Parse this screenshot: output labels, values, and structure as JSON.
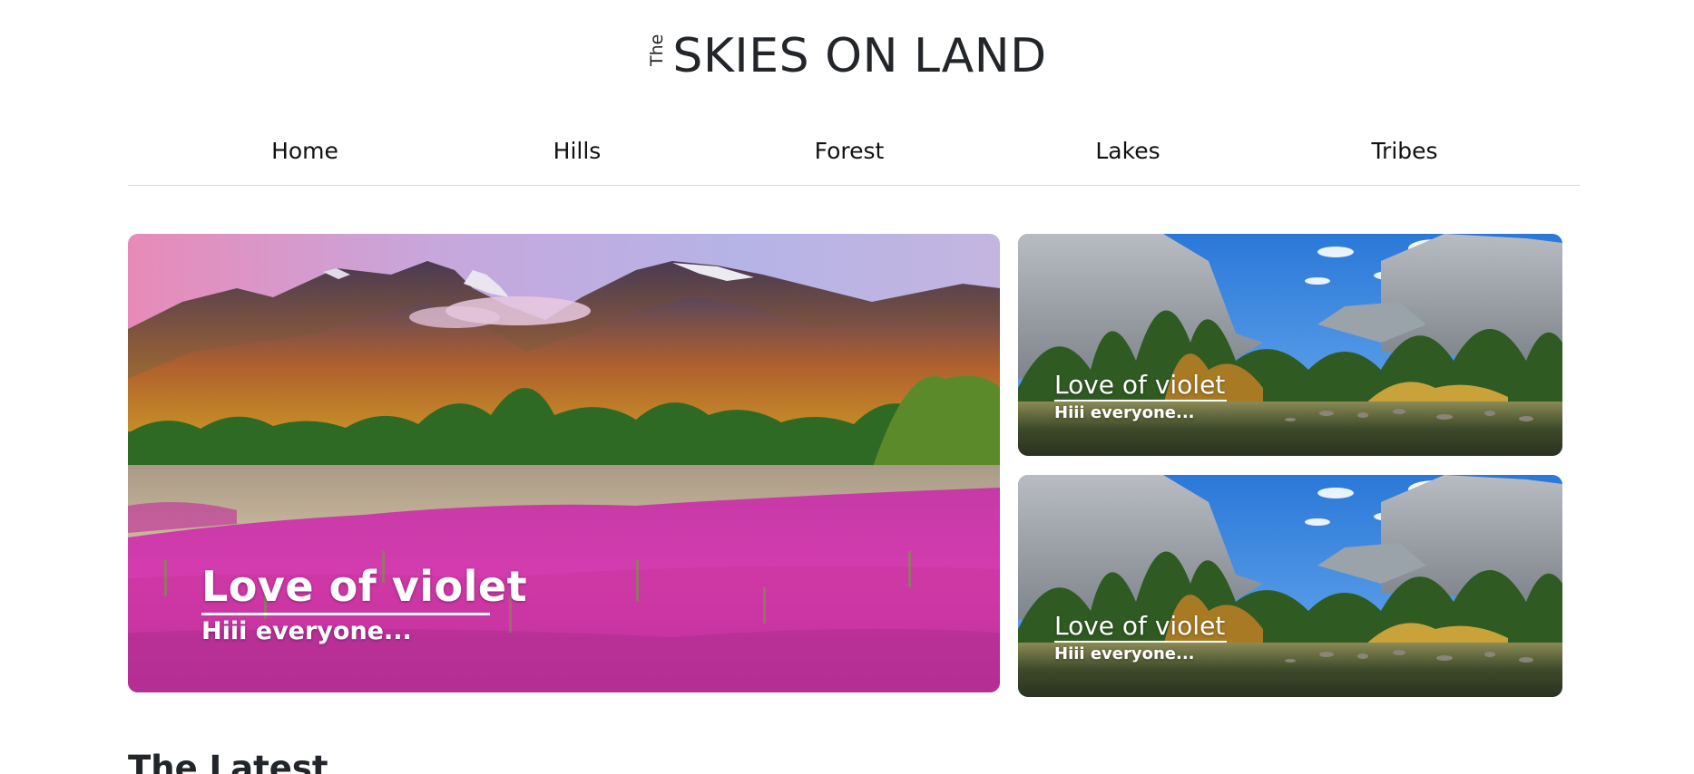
{
  "header": {
    "brand_small": "The",
    "brand_title": "SKIES ON LAND"
  },
  "nav": {
    "items": [
      {
        "label": "Home"
      },
      {
        "label": "Hills"
      },
      {
        "label": "Forest"
      },
      {
        "label": "Lakes"
      },
      {
        "label": "Tribes"
      }
    ]
  },
  "featured": {
    "main": {
      "title": "Love of violet",
      "subtitle": "Hiii everyone..."
    },
    "side": [
      {
        "title": "Love of violet",
        "subtitle": "Hiii everyone..."
      },
      {
        "title": "Love of violet",
        "subtitle": "Hiii everyone..."
      }
    ]
  },
  "latest": {
    "heading": "The Latest"
  }
}
